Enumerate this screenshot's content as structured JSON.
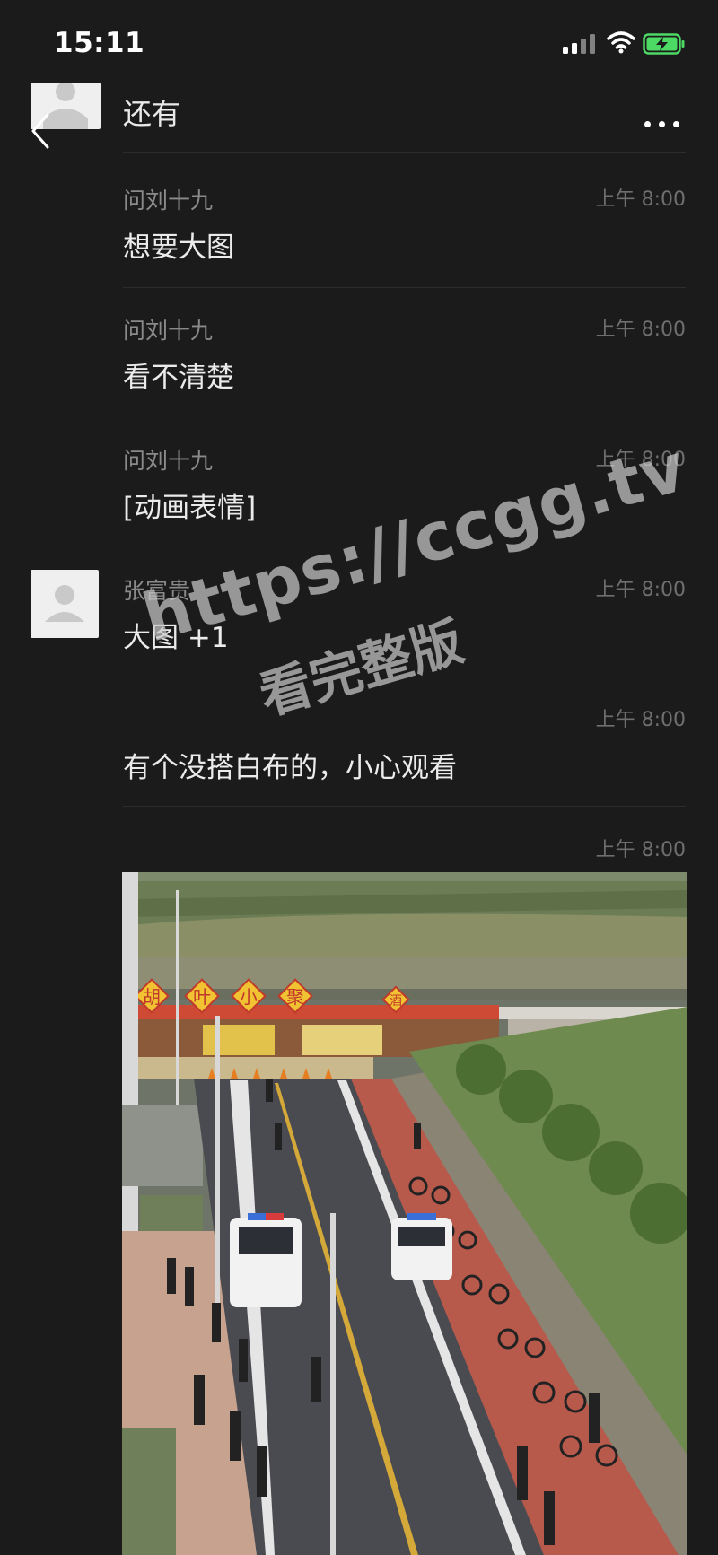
{
  "status_bar": {
    "time": "15:11"
  },
  "header": {
    "title": "还有"
  },
  "messages": [
    {
      "sender": "问刘十九",
      "time": "上午 8:00",
      "text": "想要大图"
    },
    {
      "sender": "问刘十九",
      "time": "上午 8:00",
      "text": "看不清楚"
    },
    {
      "sender": "问刘十九",
      "time": "上午 8:00",
      "text": "[动画表情]"
    },
    {
      "sender": "张富贵",
      "time": "上午 8:00",
      "text": "大图 +1"
    },
    {
      "sender": "",
      "time": "上午 8:00",
      "text": "有个没搭白布的，小心观看"
    },
    {
      "sender": "",
      "time": "上午 8:00",
      "text": ""
    }
  ],
  "watermark": {
    "line1": "https://ccgg.tv",
    "line2": "看完整版"
  },
  "photo": {
    "signs": [
      "胡",
      "叶",
      "小",
      "聚",
      "酒"
    ]
  }
}
